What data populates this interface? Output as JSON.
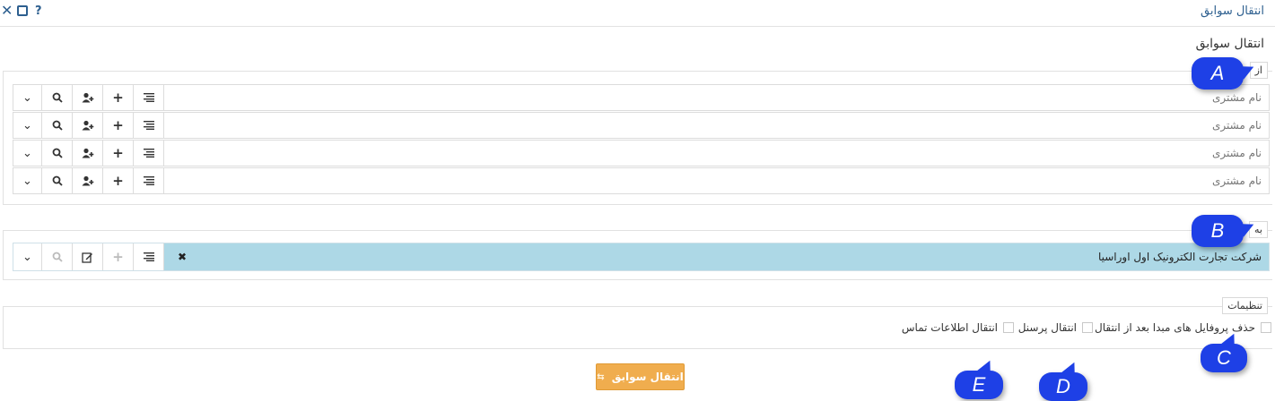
{
  "window": {
    "title": "انتقال سوابق",
    "close_icon": "close-icon",
    "maximize_icon": "maximize-icon",
    "help_icon": "help-icon"
  },
  "page": {
    "heading": "انتقال سوابق"
  },
  "from_section": {
    "legend": "از",
    "rows": [
      {
        "placeholder": "نام مشتری"
      },
      {
        "placeholder": "نام مشتری"
      },
      {
        "placeholder": "نام مشتری"
      },
      {
        "placeholder": "نام مشتری"
      }
    ],
    "buttons": [
      "list-icon",
      "plus-icon",
      "add-user-icon",
      "search-icon",
      "chevron-down-icon"
    ]
  },
  "to_section": {
    "legend": "به",
    "value": "شرکت تجارت الکترونیک اول اوراسیا",
    "clear_icon": "close-icon",
    "buttons": [
      "list-icon",
      "plus-icon",
      "edit-icon",
      "search-icon",
      "chevron-down-icon"
    ]
  },
  "settings_section": {
    "legend": "تنظیمات",
    "options": [
      {
        "label": "حذف پروفایل های مبدا بعد از انتقال",
        "checked": false
      },
      {
        "label": "انتقال پرسنل",
        "checked": false
      },
      {
        "label": "انتقال اطلاعات تماس",
        "checked": false
      }
    ]
  },
  "submit": {
    "label": "انتقال سوابق",
    "icon": "transfer-icon",
    "color": "#f0ad4e"
  },
  "callouts": {
    "a": "A",
    "b": "B",
    "c": "C",
    "d": "D",
    "e": "E",
    "color": "#1e40e6"
  }
}
